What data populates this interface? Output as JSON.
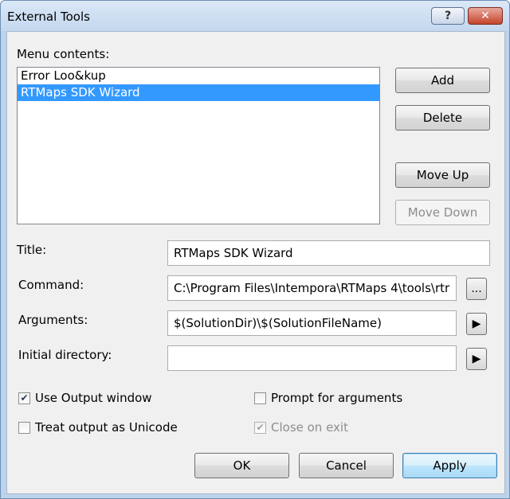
{
  "window": {
    "title": "External Tools",
    "help_label": "?",
    "close_label": "✕"
  },
  "menu": {
    "label": "Menu contents:",
    "items": [
      {
        "label": "Error Loo&kup",
        "selected": false
      },
      {
        "label": "RTMaps SDK Wizard",
        "selected": true
      }
    ]
  },
  "buttons": {
    "add": "Add",
    "delete": "Delete",
    "move_up": "Move Up",
    "move_down": "Move Down",
    "ok": "OK",
    "cancel": "Cancel",
    "apply": "Apply"
  },
  "fields": {
    "title": {
      "label": "Title:",
      "value": "RTMaps SDK Wizard"
    },
    "command": {
      "label": "Command:",
      "value": "C:\\Program Files\\Intempora\\RTMaps 4\\tools\\rtr",
      "browse_label": "..."
    },
    "arguments": {
      "label": "Arguments:",
      "value": "$(SolutionDir)\\$(SolutionFileName)",
      "arrow": "▶"
    },
    "initial_directory": {
      "label": "Initial directory:",
      "value": "",
      "arrow": "▶"
    }
  },
  "options": {
    "use_output_window": {
      "label": "Use Output window",
      "checked": true,
      "enabled": true
    },
    "treat_output_unicode": {
      "label": "Treat output as Unicode",
      "checked": false,
      "enabled": true
    },
    "prompt_for_arguments": {
      "label": "Prompt for arguments",
      "checked": false,
      "enabled": true
    },
    "close_on_exit": {
      "label": "Close on exit",
      "checked": true,
      "enabled": false
    }
  }
}
